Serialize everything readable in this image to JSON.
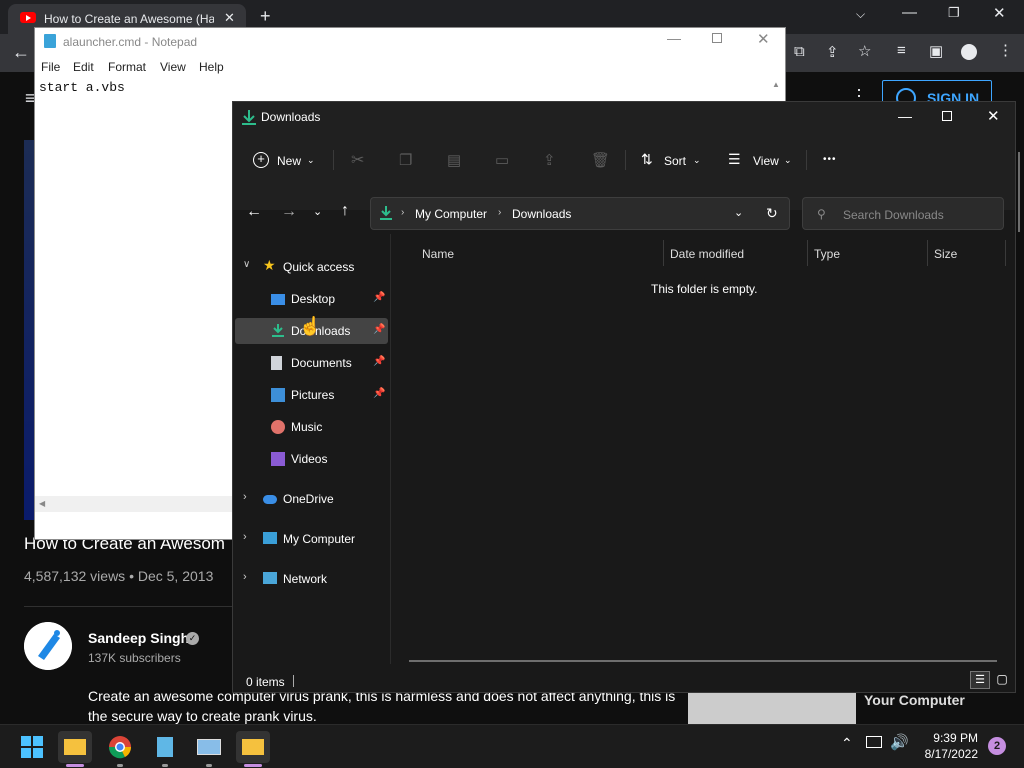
{
  "browser": {
    "tab_title": "How to Create an Awesome (Har",
    "tab_close": "✕",
    "new_tab": "+"
  },
  "youtube": {
    "sign_in": "SIGN IN",
    "video_title": "How to Create an Awesom",
    "meta": "4,587,132 views • Dec 5, 2013",
    "channel": "Sandeep Singh",
    "subscribers": "137K subscribers",
    "description": "Create an awesome computer virus prank, this is harmless and does not affect anything, this is the secure way to create prank virus.",
    "related_title": "Your Computer"
  },
  "notepad": {
    "title": "alauncher.cmd - Notepad",
    "menu": [
      "File",
      "Edit",
      "Format",
      "View",
      "Help"
    ],
    "content": "start a.vbs"
  },
  "explorer": {
    "title": "Downloads",
    "toolbar": {
      "new": "New",
      "sort": "Sort",
      "view": "View",
      "more": "•••"
    },
    "breadcrumb": [
      "My Computer",
      "Downloads"
    ],
    "search_placeholder": "Search Downloads",
    "quick_access": "Quick access",
    "pinned": [
      {
        "label": "Desktop",
        "pinned": true
      },
      {
        "label": "Downloads",
        "pinned": true,
        "selected": true
      },
      {
        "label": "Documents",
        "pinned": true
      },
      {
        "label": "Pictures",
        "pinned": true
      },
      {
        "label": "Music",
        "pinned": false
      },
      {
        "label": "Videos",
        "pinned": false
      }
    ],
    "roots": [
      "OneDrive",
      "My Computer",
      "Network"
    ],
    "columns": [
      "Name",
      "Date modified",
      "Type",
      "Size"
    ],
    "empty_message": "This folder is empty.",
    "status": "0 items"
  },
  "taskbar": {
    "time": "9:39 PM",
    "date": "8/17/2022",
    "notifications": "2"
  },
  "colors": {
    "accent_download": "#2dbd8c",
    "youtube_blue": "#3ea6ff",
    "selected_row": "#444444"
  }
}
